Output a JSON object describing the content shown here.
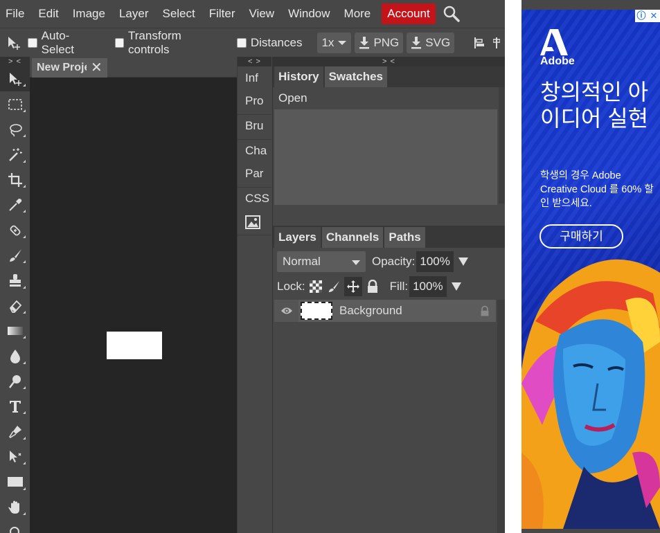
{
  "menubar": {
    "items": [
      "File",
      "Edit",
      "Image",
      "Layer",
      "Select",
      "Filter",
      "View",
      "Window",
      "More"
    ],
    "account": "Account",
    "search_icon": "search-icon"
  },
  "options": {
    "auto_select": "Auto-Select",
    "transform_controls": "Transform controls",
    "distances": "Distances",
    "zoom": "1x",
    "png": "PNG",
    "svg": "SVG"
  },
  "toolpanel": {
    "collapse": "> <",
    "tools": [
      "move-tool-icon",
      "marquee-tool-icon",
      "lasso-tool-icon",
      "magic-wand-tool-icon",
      "crop-tool-icon",
      "eyedropper-tool-icon",
      "healing-brush-tool-icon",
      "brush-tool-icon",
      "clone-stamp-tool-icon",
      "eraser-tool-icon",
      "gradient-tool-icon",
      "blur-tool-icon",
      "dodge-tool-icon",
      "text-tool-icon",
      "pen-tool-icon",
      "path-select-tool-icon",
      "shape-tool-icon",
      "hand-tool-icon",
      "zoom-tool-icon"
    ]
  },
  "document": {
    "tab_label": "New Project",
    "close": "✕"
  },
  "minipanel": {
    "collapse": "< >",
    "items": [
      "Inf",
      "Pro",
      "Bru",
      "Cha",
      "Par",
      "CSS"
    ]
  },
  "history_panel": {
    "collapse": "> <",
    "tabs": [
      "History",
      "Swatches"
    ],
    "rows": [
      "Open"
    ]
  },
  "layers_panel": {
    "tabs": [
      "Layers",
      "Channels",
      "Paths"
    ],
    "blend_mode": "Normal",
    "opacity_label": "Opacity:",
    "opacity_value": "100%",
    "lock_label": "Lock:",
    "fill_label": "Fill:",
    "fill_value": "100%",
    "layers": [
      {
        "name": "Background"
      }
    ]
  },
  "ad": {
    "brand": "Adobe",
    "headline": "창의적인 아이디어 실현",
    "sub": "학생의 경우 Adobe Creative Cloud 를 60% 할인 받으세요.",
    "cta": "구매하기",
    "info": "ⓘ",
    "close": "✕"
  }
}
